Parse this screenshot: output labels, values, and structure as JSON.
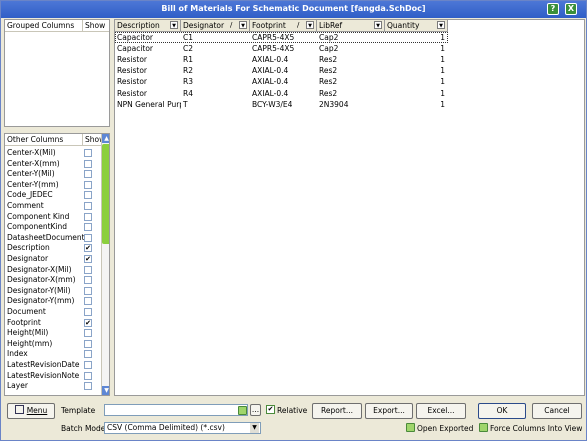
{
  "window": {
    "title": "Bill of Materials For Schematic Document [fangda.SchDoc]",
    "help_label": "?",
    "close_label": "X"
  },
  "grouped_columns": {
    "header": "Grouped Columns",
    "show_header": "Show"
  },
  "other_columns": {
    "header": "Other Columns",
    "show_header": "Show",
    "scroll_up": "▲",
    "scroll_down": "▼",
    "items": [
      {
        "label": "Center-X(Mil)",
        "checked": false
      },
      {
        "label": "Center-X(mm)",
        "checked": false
      },
      {
        "label": "Center-Y(Mil)",
        "checked": false
      },
      {
        "label": "Center-Y(mm)",
        "checked": false
      },
      {
        "label": "Code_JEDEC",
        "checked": false
      },
      {
        "label": "Comment",
        "checked": false
      },
      {
        "label": "Component Kind",
        "checked": false
      },
      {
        "label": "ComponentKind",
        "checked": false
      },
      {
        "label": "DatasheetDocument",
        "checked": false
      },
      {
        "label": "Description",
        "checked": true
      },
      {
        "label": "Designator",
        "checked": true
      },
      {
        "label": "Designator-X(Mil)",
        "checked": false
      },
      {
        "label": "Designator-X(mm)",
        "checked": false
      },
      {
        "label": "Designator-Y(Mil)",
        "checked": false
      },
      {
        "label": "Designator-Y(mm)",
        "checked": false
      },
      {
        "label": "Document",
        "checked": false
      },
      {
        "label": "Footprint",
        "checked": true
      },
      {
        "label": "Height(Mil)",
        "checked": false
      },
      {
        "label": "Height(mm)",
        "checked": false
      },
      {
        "label": "Index",
        "checked": false
      },
      {
        "label": "LatestRevisionDate",
        "checked": false
      },
      {
        "label": "LatestRevisionNote",
        "checked": false
      },
      {
        "label": "Layer",
        "checked": false
      }
    ]
  },
  "grid": {
    "columns": [
      {
        "label": "Description",
        "sort": ""
      },
      {
        "label": "Designator",
        "sort": "/"
      },
      {
        "label": "Footprint",
        "sort": "/"
      },
      {
        "label": "LibRef",
        "sort": ""
      },
      {
        "label": "Quantity",
        "sort": ""
      }
    ],
    "rows": [
      {
        "description": "Capacitor",
        "designator": "C1",
        "footprint": "CAPR5-4X5",
        "libref": "Cap2",
        "quantity": "1"
      },
      {
        "description": "Capacitor",
        "designator": "C2",
        "footprint": "CAPR5-4X5",
        "libref": "Cap2",
        "quantity": "1"
      },
      {
        "description": "Resistor",
        "designator": "R1",
        "footprint": "AXIAL-0.4",
        "libref": "Res2",
        "quantity": "1"
      },
      {
        "description": "Resistor",
        "designator": "R2",
        "footprint": "AXIAL-0.4",
        "libref": "Res2",
        "quantity": "1"
      },
      {
        "description": "Resistor",
        "designator": "R3",
        "footprint": "AXIAL-0.4",
        "libref": "Res2",
        "quantity": "1"
      },
      {
        "description": "Resistor",
        "designator": "R4",
        "footprint": "AXIAL-0.4",
        "libref": "Res2",
        "quantity": "1"
      },
      {
        "description": "NPN General Purpo:",
        "designator": "T",
        "footprint": "BCY-W3/E4",
        "libref": "2N3904",
        "quantity": "1"
      }
    ]
  },
  "bottom": {
    "menu_label": "Menu",
    "template_label": "Template",
    "template_value": "",
    "browse_label": "...",
    "relative_label": "Relative",
    "relative_checked": true,
    "report_label": "Report...",
    "export_label": "Export...",
    "excel_label": "Excel...",
    "ok_label": "OK",
    "cancel_label": "Cancel",
    "batch_mode_label": "Batch Mode",
    "batch_mode_value": "CSV (Comma Delimited) (*.csv)",
    "open_exported_label": "Open Exported",
    "force_columns_label": "Force Columns Into View"
  }
}
